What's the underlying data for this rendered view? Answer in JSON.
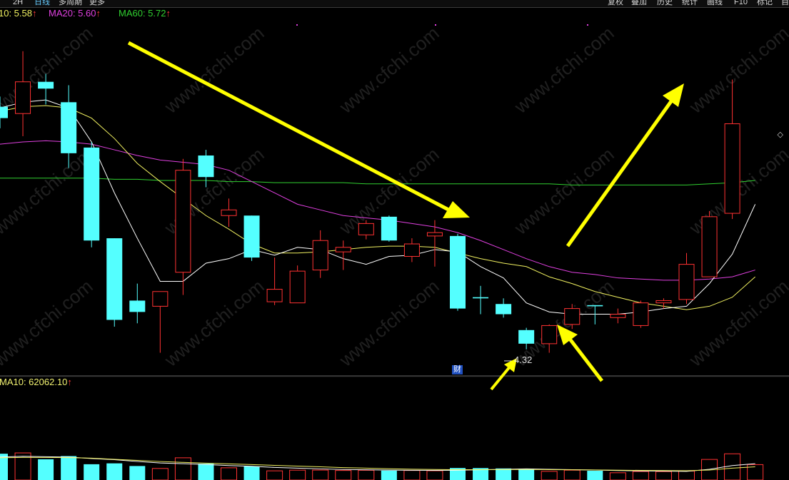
{
  "toolbar": {
    "left_items": [
      "2H",
      "日线",
      "多周期",
      "更多"
    ],
    "right_items": [
      "复权",
      "叠加",
      "历史",
      "统计",
      "画线",
      "F10",
      "标记",
      "自"
    ]
  },
  "legend": {
    "ma10": {
      "label": "10: 5.58",
      "arrow": "↑",
      "color": "#f0f060"
    },
    "ma20": {
      "label": "MA20: 5.60",
      "arrow": "↑",
      "color": "#e040e0"
    },
    "ma60": {
      "label": "MA60: 5.72",
      "arrow": "↑",
      "color": "#30d030"
    }
  },
  "volume_legend": {
    "label": "MA10: 62062.10",
    "arrow": "↑"
  },
  "annotations": {
    "low_value": "4.32",
    "cai_badge": "财"
  },
  "watermark": "www.cfchi.com",
  "colors": {
    "up": "#ff3232",
    "down": "#54ffff",
    "ma5": "#ffffff",
    "ma10": "#f0f060",
    "ma20": "#e040e0",
    "ma60": "#30d030",
    "arrow": "#ffff00",
    "background": "#000000"
  },
  "chart_data": {
    "type": "candlestick",
    "y_range": [
      4.2,
      7.05
    ],
    "volume_range": [
      0,
      80000
    ],
    "candles": [
      {
        "o": 6.36,
        "h": 6.45,
        "l": 6.17,
        "c": 6.26
      },
      {
        "o": 6.3,
        "h": 6.85,
        "l": 6.1,
        "c": 6.58
      },
      {
        "o": 6.58,
        "h": 6.65,
        "l": 6.38,
        "c": 6.52
      },
      {
        "o": 6.4,
        "h": 6.55,
        "l": 5.82,
        "c": 5.95
      },
      {
        "o": 6.0,
        "h": 6.05,
        "l": 5.12,
        "c": 5.18
      },
      {
        "o": 5.2,
        "h": 5.2,
        "l": 4.42,
        "c": 4.48
      },
      {
        "o": 4.65,
        "h": 4.8,
        "l": 4.45,
        "c": 4.55
      },
      {
        "o": 4.6,
        "h": 4.73,
        "l": 4.19,
        "c": 4.73
      },
      {
        "o": 4.9,
        "h": 5.9,
        "l": 4.7,
        "c": 5.8
      },
      {
        "o": 5.93,
        "h": 5.98,
        "l": 5.65,
        "c": 5.74
      },
      {
        "o": 5.4,
        "h": 5.55,
        "l": 5.3,
        "c": 5.45
      },
      {
        "o": 5.4,
        "h": 5.4,
        "l": 5.0,
        "c": 5.03
      },
      {
        "o": 4.64,
        "h": 5.03,
        "l": 4.61,
        "c": 4.75
      },
      {
        "o": 4.63,
        "h": 4.96,
        "l": 4.63,
        "c": 4.91
      },
      {
        "o": 4.92,
        "h": 5.27,
        "l": 4.85,
        "c": 5.18
      },
      {
        "o": 5.08,
        "h": 5.18,
        "l": 4.92,
        "c": 5.12
      },
      {
        "o": 5.23,
        "h": 5.36,
        "l": 5.19,
        "c": 5.33
      },
      {
        "o": 5.39,
        "h": 5.4,
        "l": 5.17,
        "c": 5.18
      },
      {
        "o": 5.04,
        "h": 5.2,
        "l": 4.99,
        "c": 5.15
      },
      {
        "o": 5.22,
        "h": 5.36,
        "l": 4.95,
        "c": 5.25
      },
      {
        "o": 5.22,
        "h": 5.24,
        "l": 4.56,
        "c": 4.58
      },
      {
        "o": 4.68,
        "h": 4.78,
        "l": 4.53,
        "c": 4.67
      },
      {
        "o": 4.62,
        "h": 4.67,
        "l": 4.5,
        "c": 4.53
      },
      {
        "o": 4.39,
        "h": 4.41,
        "l": 4.22,
        "c": 4.27
      },
      {
        "o": 4.27,
        "h": 4.44,
        "l": 4.19,
        "c": 4.43
      },
      {
        "o": 4.44,
        "h": 4.62,
        "l": 4.4,
        "c": 4.58
      },
      {
        "o": 4.61,
        "h": 4.61,
        "l": 4.44,
        "c": 4.6
      },
      {
        "o": 4.5,
        "h": 4.58,
        "l": 4.45,
        "c": 4.53
      },
      {
        "o": 4.43,
        "h": 4.65,
        "l": 4.41,
        "c": 4.63
      },
      {
        "o": 4.63,
        "h": 4.67,
        "l": 4.58,
        "c": 4.65
      },
      {
        "o": 4.66,
        "h": 5.07,
        "l": 4.62,
        "c": 4.97
      },
      {
        "o": 4.86,
        "h": 5.44,
        "l": 4.86,
        "c": 5.39
      },
      {
        "o": 5.42,
        "h": 6.6,
        "l": 5.37,
        "c": 6.21
      }
    ],
    "volume": [
      35500,
      36600,
      28000,
      32300,
      21300,
      22500,
      18900,
      15600,
      30000,
      22000,
      16500,
      18400,
      12400,
      13300,
      13400,
      12900,
      13200,
      12700,
      12900,
      12500,
      16200,
      16100,
      15600,
      15200,
      11700,
      13300,
      12500,
      9800,
      11500,
      11400,
      12100,
      27800,
      35400,
      20800
    ],
    "ma5": [
      6.35,
      6.4,
      6.42,
      6.35,
      6.05,
      5.6,
      5.2,
      4.82,
      4.82,
      4.98,
      5.02,
      5.1,
      5.05,
      5.12,
      5.1,
      5.02,
      4.97,
      5.04,
      5.05,
      5.1,
      5.08,
      4.95,
      4.85,
      4.63,
      4.55,
      4.53,
      4.53,
      4.53,
      4.55,
      4.58,
      4.6,
      4.8,
      5.06,
      5.5
    ],
    "ma10": [
      6.32,
      6.36,
      6.37,
      6.35,
      6.26,
      6.08,
      5.86,
      5.7,
      5.55,
      5.4,
      5.28,
      5.15,
      5.07,
      5.07,
      5.08,
      5.1,
      5.12,
      5.13,
      5.13,
      5.12,
      5.07,
      5.02,
      4.98,
      4.95,
      4.86,
      4.8,
      4.73,
      4.68,
      4.63,
      4.6,
      4.57,
      4.6,
      4.68,
      4.86
    ],
    "ma20": [
      6.03,
      6.05,
      6.06,
      6.05,
      6.03,
      5.98,
      5.93,
      5.89,
      5.87,
      5.85,
      5.8,
      5.7,
      5.6,
      5.5,
      5.45,
      5.4,
      5.38,
      5.36,
      5.33,
      5.3,
      5.25,
      5.18,
      5.1,
      5.02,
      4.95,
      4.9,
      4.88,
      4.85,
      4.84,
      4.83,
      4.83,
      4.84,
      4.86,
      4.92
    ],
    "ma60": [
      5.73,
      5.73,
      5.73,
      5.73,
      5.73,
      5.72,
      5.72,
      5.71,
      5.71,
      5.71,
      5.7,
      5.7,
      5.69,
      5.69,
      5.69,
      5.69,
      5.68,
      5.68,
      5.68,
      5.68,
      5.68,
      5.68,
      5.68,
      5.68,
      5.68,
      5.67,
      5.67,
      5.67,
      5.67,
      5.67,
      5.67,
      5.68,
      5.69,
      5.71
    ],
    "vol_ma5": [
      31000,
      32000,
      31500,
      31000,
      29000,
      27500,
      25000,
      23000,
      22000,
      21000,
      19500,
      18500,
      17000,
      16000,
      15000,
      14200,
      13800,
      13400,
      13100,
      13000,
      13200,
      13800,
      14500,
      15000,
      14500,
      14000,
      13500,
      12800,
      12300,
      12000,
      11700,
      14500,
      19500,
      22000
    ],
    "vol_ma10": [
      30000,
      30500,
      30500,
      30300,
      29500,
      28000,
      26500,
      25000,
      23800,
      22800,
      21800,
      20800,
      19800,
      18800,
      17800,
      16800,
      16000,
      15200,
      14600,
      14200,
      14000,
      14000,
      14100,
      14200,
      14000,
      13800,
      13600,
      13300,
      13000,
      12800,
      12500,
      13500,
      16000,
      17800
    ]
  }
}
